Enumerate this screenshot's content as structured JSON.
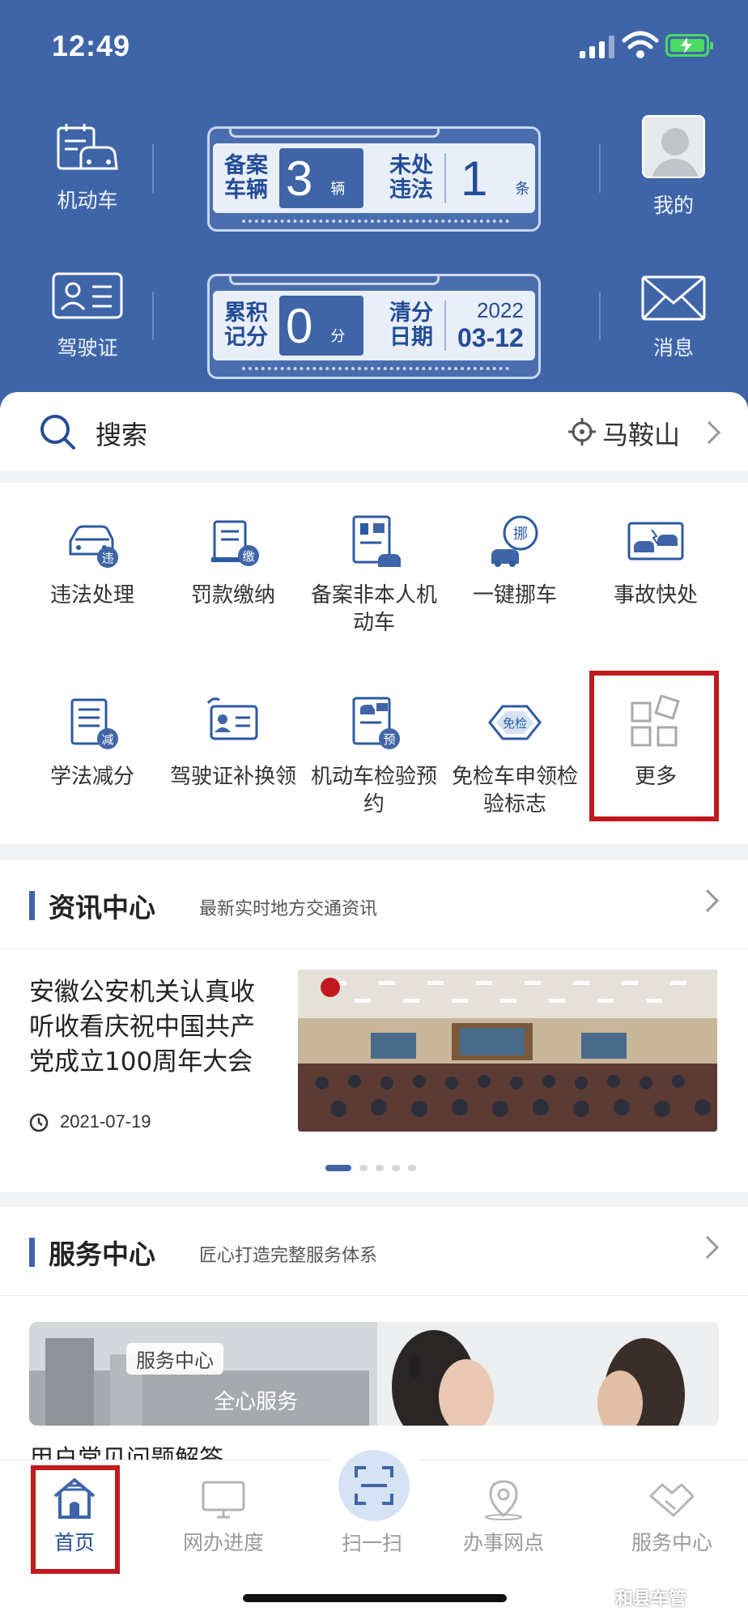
{
  "status_bar": {
    "time": "12:49"
  },
  "header": {
    "vehicle_label": "机动车",
    "license_label": "驾驶证",
    "mine_label": "我的",
    "message_label": "消息",
    "vehicle_card": {
      "registered_label": "备案车辆",
      "registered_line1": "备案",
      "registered_line2": "车辆",
      "registered_count": "3",
      "registered_unit": "辆",
      "violation_line1": "未处",
      "violation_line2": "违法",
      "violation_count": "1",
      "violation_unit": "条"
    },
    "license_card": {
      "points_line1": "累积",
      "points_line2": "记分",
      "points_value": "0",
      "points_unit": "分",
      "clear_line1": "清分",
      "clear_line2": "日期",
      "clear_year": "2022",
      "clear_date": "03-12"
    }
  },
  "search": {
    "placeholder": "搜索",
    "location": "马鞍山"
  },
  "menu": [
    {
      "label": "违法处理",
      "icon": "violation-car-icon"
    },
    {
      "label": "罚款缴纳",
      "icon": "fine-payment-icon"
    },
    {
      "label": "备案非本人机动车",
      "icon": "register-vehicle-icon"
    },
    {
      "label": "一键挪车",
      "icon": "move-car-icon"
    },
    {
      "label": "事故快处",
      "icon": "accident-icon"
    },
    {
      "label": "学法减分",
      "icon": "study-deduct-icon"
    },
    {
      "label": "驾驶证补换领",
      "icon": "license-replace-icon"
    },
    {
      "label": "机动车检验预约",
      "icon": "inspection-appointment-icon"
    },
    {
      "label": "免检车申领检验标志",
      "icon": "exempt-inspection-icon"
    },
    {
      "label": "更多",
      "icon": "more-grid-icon"
    }
  ],
  "news": {
    "title": "资讯中心",
    "subtitle": "最新实时地方交通资讯",
    "article_title": "安徽公安机关认真收听收看庆祝中国共产党成立100周年大会",
    "article_date": "2021-07-19"
  },
  "service": {
    "title": "服务中心",
    "subtitle": "匠心打造完整服务体系",
    "banner_tag": "服务中心",
    "banner_text": "全心服务",
    "faq_text": "用户常见问题解答"
  },
  "tabbar": [
    {
      "label": "首页",
      "icon": "home-icon",
      "active": true
    },
    {
      "label": "网办进度",
      "icon": "monitor-icon",
      "active": false
    },
    {
      "label": "扫一扫",
      "icon": "scan-icon",
      "active": false
    },
    {
      "label": "办事网点",
      "icon": "location-pin-icon",
      "active": false
    },
    {
      "label": "服务中心",
      "icon": "handshake-icon",
      "active": false
    }
  ],
  "watermark": "和县车管",
  "colors": {
    "primary": "#3f65a8",
    "highlight": "#c0191e",
    "text": "#333333"
  }
}
